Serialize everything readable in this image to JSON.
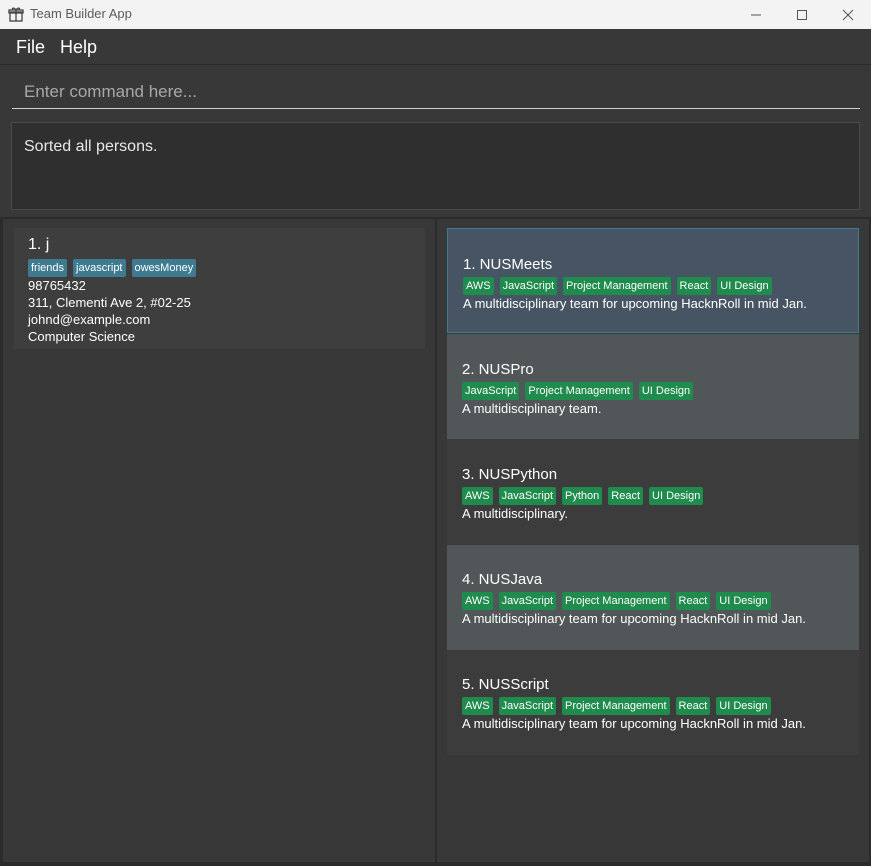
{
  "window": {
    "title": "Team Builder App"
  },
  "menu": {
    "file": "File",
    "help": "Help"
  },
  "command": {
    "placeholder": "Enter command here..."
  },
  "result": {
    "text": "Sorted all persons."
  },
  "persons": [
    {
      "name": "1.  j",
      "tags": [
        "friends",
        "javascript",
        "owesMoney"
      ],
      "phone": "98765432",
      "address": "311, Clementi Ave 2, #02-25",
      "email": "johnd@example.com",
      "major": "Computer Science"
    }
  ],
  "teams": [
    {
      "name": "1.  NUSMeets",
      "tags": [
        "AWS",
        "JavaScript",
        "Project Management",
        "React",
        "UI Design"
      ],
      "desc": "A multidisciplinary team for upcoming HacknRoll in mid Jan."
    },
    {
      "name": "2.  NUSPro",
      "tags": [
        "JavaScript",
        "Project Management",
        "UI Design"
      ],
      "desc": "A multidisciplinary team."
    },
    {
      "name": "3.  NUSPython",
      "tags": [
        "AWS",
        "JavaScript",
        "Python",
        "React",
        "UI Design"
      ],
      "desc": "A multidisciplinary."
    },
    {
      "name": "4.  NUSJava",
      "tags": [
        "AWS",
        "JavaScript",
        "Project Management",
        "React",
        "UI Design"
      ],
      "desc": "A multidisciplinary team for upcoming HacknRoll in mid Jan."
    },
    {
      "name": "5.  NUSScript",
      "tags": [
        "AWS",
        "JavaScript",
        "Project Management",
        "React",
        "UI Design"
      ],
      "desc": "A multidisciplinary team for upcoming HacknRoll in mid Jan."
    }
  ]
}
